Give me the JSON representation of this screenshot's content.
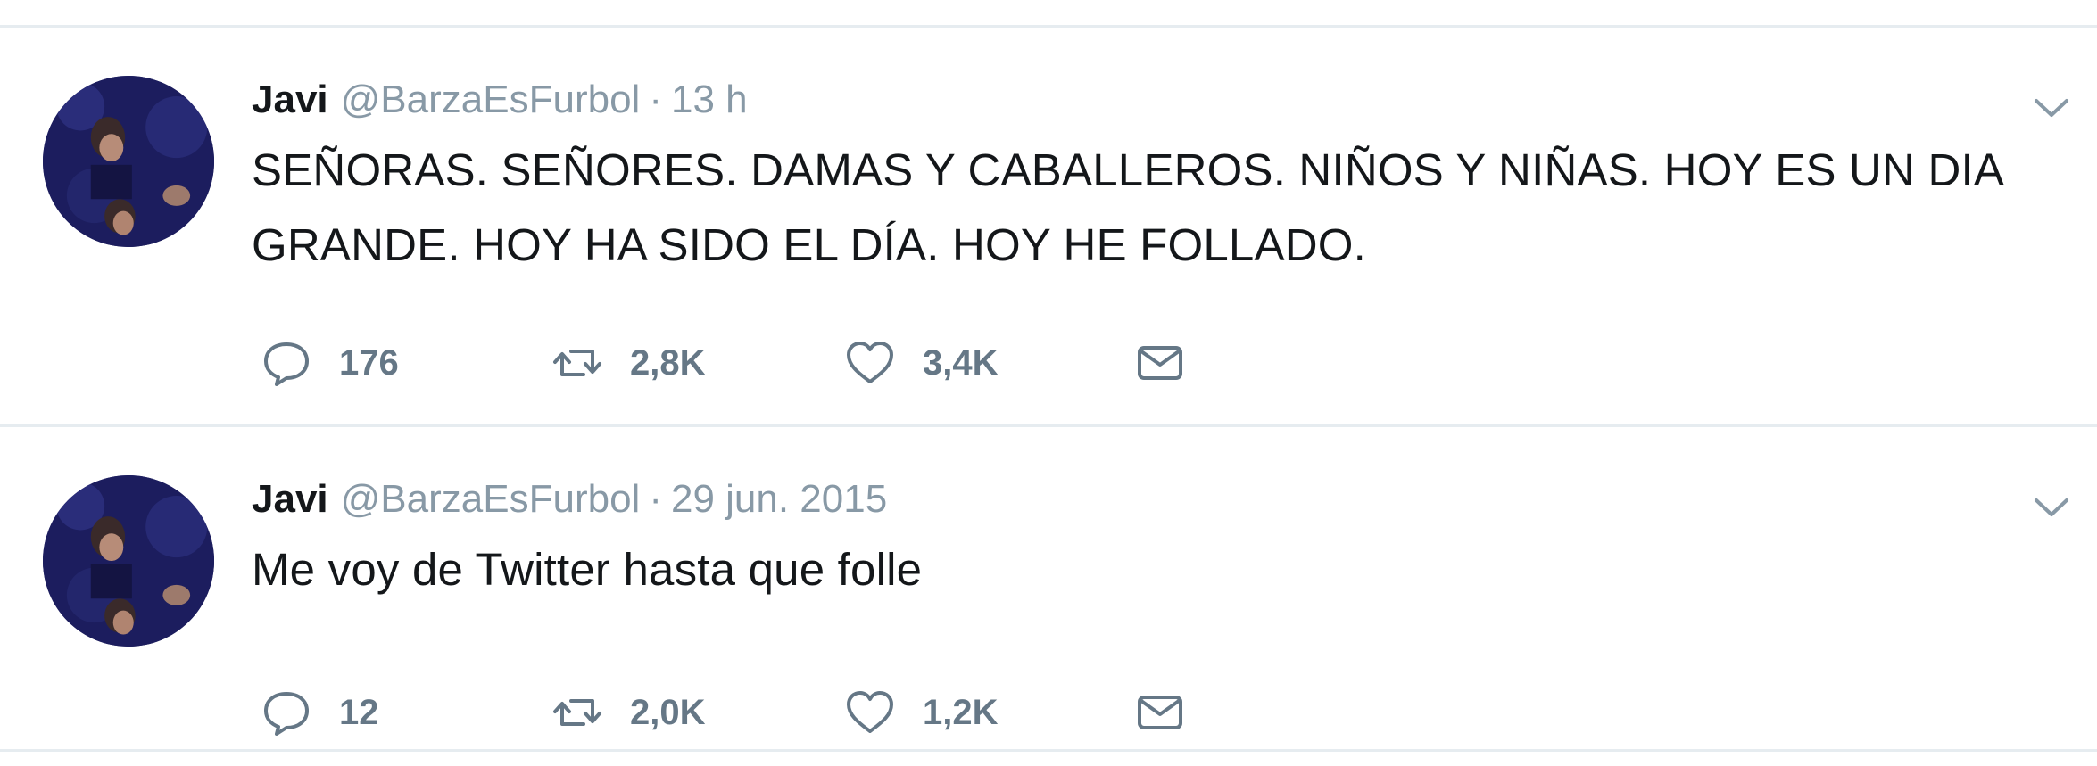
{
  "tweets": [
    {
      "author_name": "Javi",
      "handle": "@BarzaEsFurbol",
      "separator": "·",
      "time": "13 h",
      "text": "SEÑORAS. SEÑORES. DAMAS Y CABALLEROS. NIÑOS Y NIÑAS. HOY ES UN DIA GRANDE. HOY HA SIDO EL DÍA. HOY HE FOLLADO.",
      "replies": "176",
      "retweets": "2,8K",
      "likes": "3,4K"
    },
    {
      "author_name": "Javi",
      "handle": "@BarzaEsFurbol",
      "separator": "·",
      "time": "29 jun. 2015",
      "text": "Me voy de Twitter hasta que folle",
      "replies": "12",
      "retweets": "2,0K",
      "likes": "1,2K"
    }
  ],
  "icons": {
    "reply": "reply-icon",
    "retweet": "retweet-icon",
    "like": "heart-icon",
    "direct_message": "envelope-icon",
    "menu": "chevron-down-icon"
  },
  "colors": {
    "text": "#14171a",
    "secondary": "#8899a6",
    "action": "#657786",
    "divider": "#e6ecf0"
  }
}
